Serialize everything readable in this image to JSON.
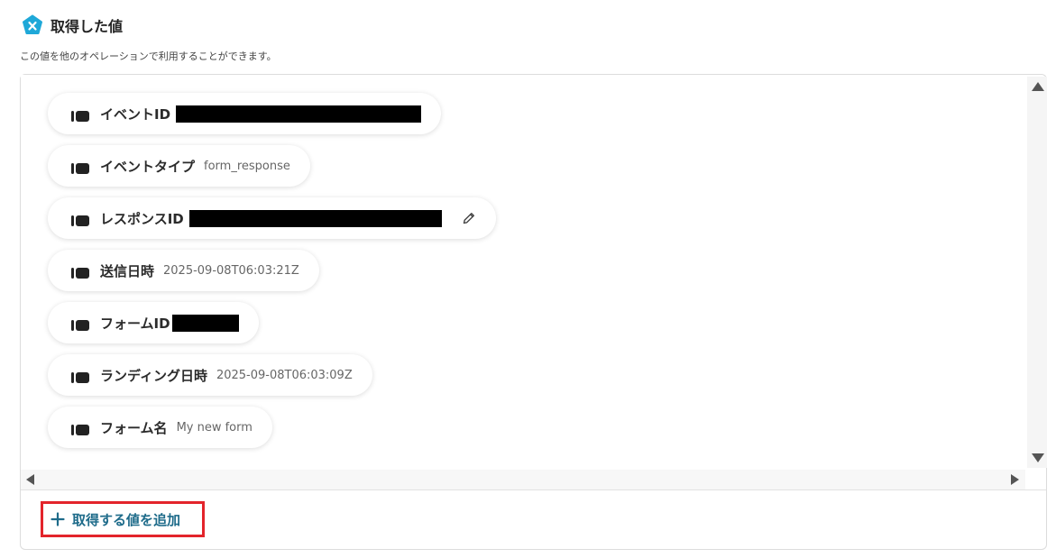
{
  "header": {
    "title": "取得した値",
    "subtitle": "この値を他のオペレーションで利用することができます。"
  },
  "fields": [
    {
      "label": "イベントID",
      "value": "",
      "redacted": true
    },
    {
      "label": "イベントタイプ",
      "value": "form_response",
      "redacted": false
    },
    {
      "label": "レスポンスID",
      "value": "",
      "redacted": true,
      "editable": true
    },
    {
      "label": "送信日時",
      "value": "2025-09-08T06:03:21Z",
      "redacted": false
    },
    {
      "label": "フォームID",
      "value": "",
      "redacted": true
    },
    {
      "label": "ランディング日時",
      "value": "2025-09-08T06:03:09Z",
      "redacted": false
    },
    {
      "label": "フォーム名",
      "value": "My new form",
      "redacted": false
    }
  ],
  "add_button": {
    "label": "取得する値を追加"
  },
  "icons": {
    "logo": "yoom-logo-icon",
    "tag": "tag-icon",
    "edit": "pencil-icon",
    "add": "plus-icon"
  },
  "colors": {
    "logo": "#1fa8d8",
    "accent_text": "#1e6b8a",
    "highlight_border": "#e3242b"
  }
}
